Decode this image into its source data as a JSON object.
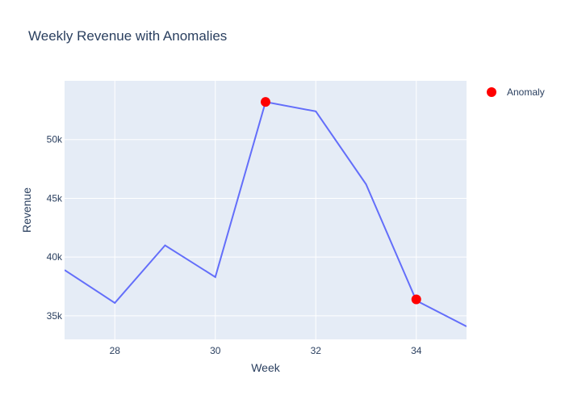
{
  "chart_data": {
    "type": "line",
    "title": "Weekly Revenue with Anomalies",
    "xlabel": "Week",
    "ylabel": "Revenue",
    "xlim": [
      27,
      35
    ],
    "ylim": [
      33000,
      55000
    ],
    "xticks": [
      28,
      30,
      32,
      34
    ],
    "yticks": [
      35000,
      40000,
      45000,
      50000
    ],
    "ytick_labels": [
      "35k",
      "40k",
      "45k",
      "50k"
    ],
    "grid": true,
    "legend_position": "top-right",
    "series": [
      {
        "x": [
          27,
          28,
          29,
          30,
          31,
          32,
          33,
          34,
          35
        ],
        "y": [
          38900,
          36100,
          41000,
          38300,
          53200,
          52400,
          46200,
          36300,
          34100
        ],
        "color": "#636efa"
      },
      {
        "name": "Anomaly",
        "mode": "markers",
        "x": [
          31,
          34
        ],
        "y": [
          53200,
          36400
        ],
        "color": "#ff0000"
      }
    ],
    "colors": {
      "plot_bg": "#e5ecf6",
      "grid": "#ffffff",
      "text": "#2a3f5f"
    }
  }
}
